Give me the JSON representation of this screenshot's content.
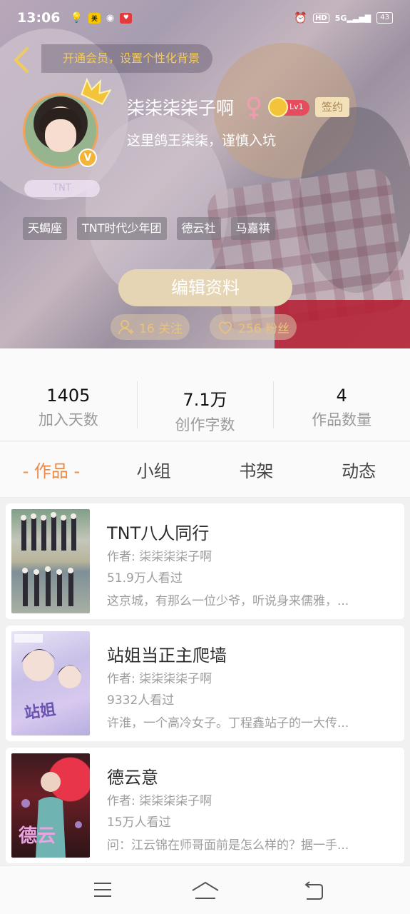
{
  "status_bar": {
    "time": "13:06",
    "network": "5G",
    "battery": "43"
  },
  "header": {
    "vip_banner": "开通会员，设置个性化背景",
    "username": "柒柒柒柒子啊",
    "level": "Lv1",
    "signed_badge": "签约",
    "bio": "这里鸽王柒柒，谨慎入坑",
    "avatar_tag": "TNT",
    "tags": [
      "天蝎座",
      "TNT时代少年团",
      "德云社",
      "马嘉祺"
    ],
    "edit_button": "编辑资料",
    "following": "16 关注",
    "followers": "256 粉丝"
  },
  "stats": [
    {
      "value": "1405",
      "label": "加入天数"
    },
    {
      "value": "7.1万",
      "label": "创作字数"
    },
    {
      "value": "4",
      "label": "作品数量"
    }
  ],
  "tabs": [
    {
      "label": "- 作品 -",
      "active": true
    },
    {
      "label": "小组",
      "active": false
    },
    {
      "label": "书架",
      "active": false
    },
    {
      "label": "动态",
      "active": false
    }
  ],
  "works": [
    {
      "title": "TNT八人同行",
      "author": "作者: 柒柒柒柒子啊",
      "views": "51.9万人看过",
      "desc": "这京城，有那么一位少爷，听说身来儒雅，..."
    },
    {
      "title": "站姐当正主爬墙",
      "author": "作者: 柒柒柒柒子啊",
      "views": "9332人看过",
      "desc": "许淮，一个高冷女子。丁程鑫站子的一大传..."
    },
    {
      "title": "德云意",
      "author": "作者: 柒柒柒柒子啊",
      "views": "15万人看过",
      "desc": "问：江云锦在师哥面前是怎么样的？据一手..."
    }
  ],
  "colors": {
    "accent": "#ef8a44",
    "gold": "#e9c27e",
    "edit_button_bg": "#e6d5b4"
  }
}
